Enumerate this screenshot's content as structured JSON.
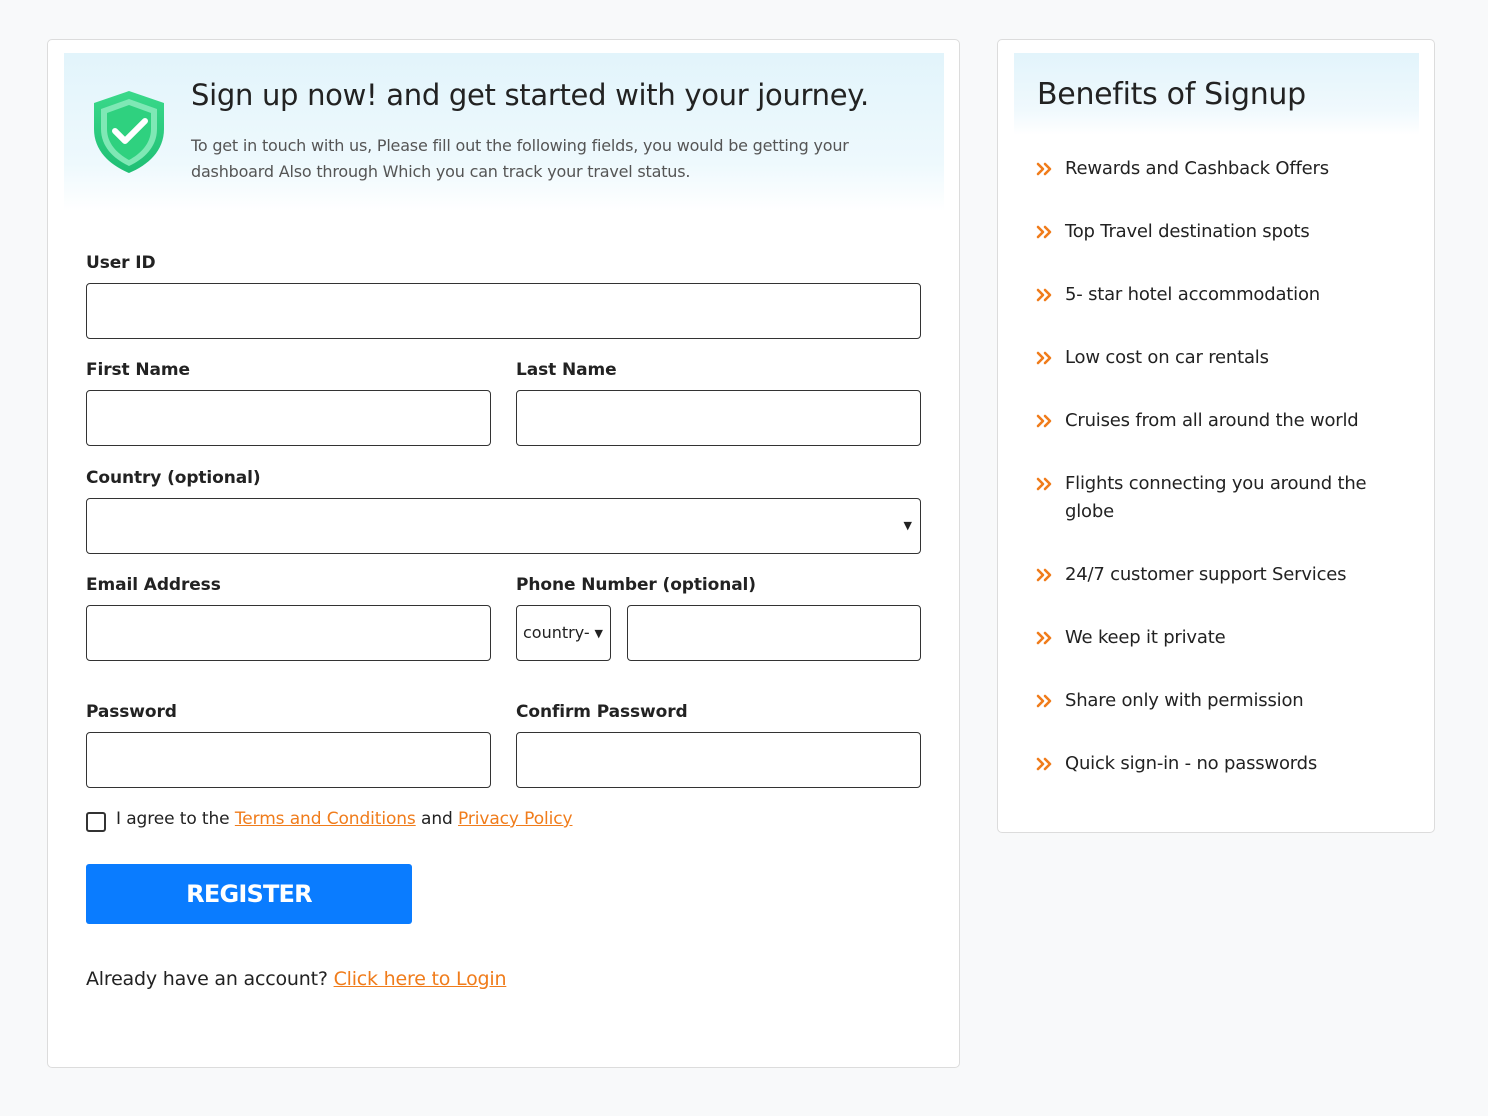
{
  "form": {
    "title": "Sign up now! and get started with your journey.",
    "description": "To get in touch with us, Please fill out the following fields, you would be getting your dashboard Also through Which you can track your travel status.",
    "labels": {
      "user_id": "User ID",
      "first_name": "First Name",
      "last_name": "Last Name",
      "country": "Country (optional)",
      "email": "Email Address",
      "phone": "Phone Number (optional)",
      "password": "Password",
      "confirm_password": "Confirm Password"
    },
    "values": {
      "user_id": "",
      "first_name": "",
      "last_name": "",
      "country": "",
      "email": "",
      "country_code": "country-",
      "phone": "",
      "password": "",
      "confirm_password": ""
    },
    "terms": {
      "prefix": "I agree to the",
      "terms_link": "Terms and Conditions",
      "and": "and",
      "privacy_link": "Privacy Policy",
      "checked": false
    },
    "register_label": "REGISTER",
    "login": {
      "prompt": "Already have an account?",
      "link": "Click here to Login"
    }
  },
  "benefits": {
    "title": "Benefits of Signup",
    "items": [
      "Rewards and Cashback Offers",
      "Top Travel destination spots",
      "5- star hotel accommodation",
      "Low cost on car rentals",
      "Cruises from all around the world",
      "Flights connecting you around the globe",
      "24/7 customer support Services",
      "We keep it private",
      "Share only with permission",
      "Quick sign-in - no passwords"
    ]
  },
  "colors": {
    "accent_orange": "#f07c1b",
    "primary_blue": "#0a7cff",
    "shield_green": "#2fd17f",
    "header_tint": "#e2f4fb",
    "page_background": "#f8f9fa"
  },
  "icons": {
    "header_icon": "shield-check-icon",
    "bullet_icon": "double-chevron-right-icon",
    "select_icon": "caret-down-icon"
  }
}
